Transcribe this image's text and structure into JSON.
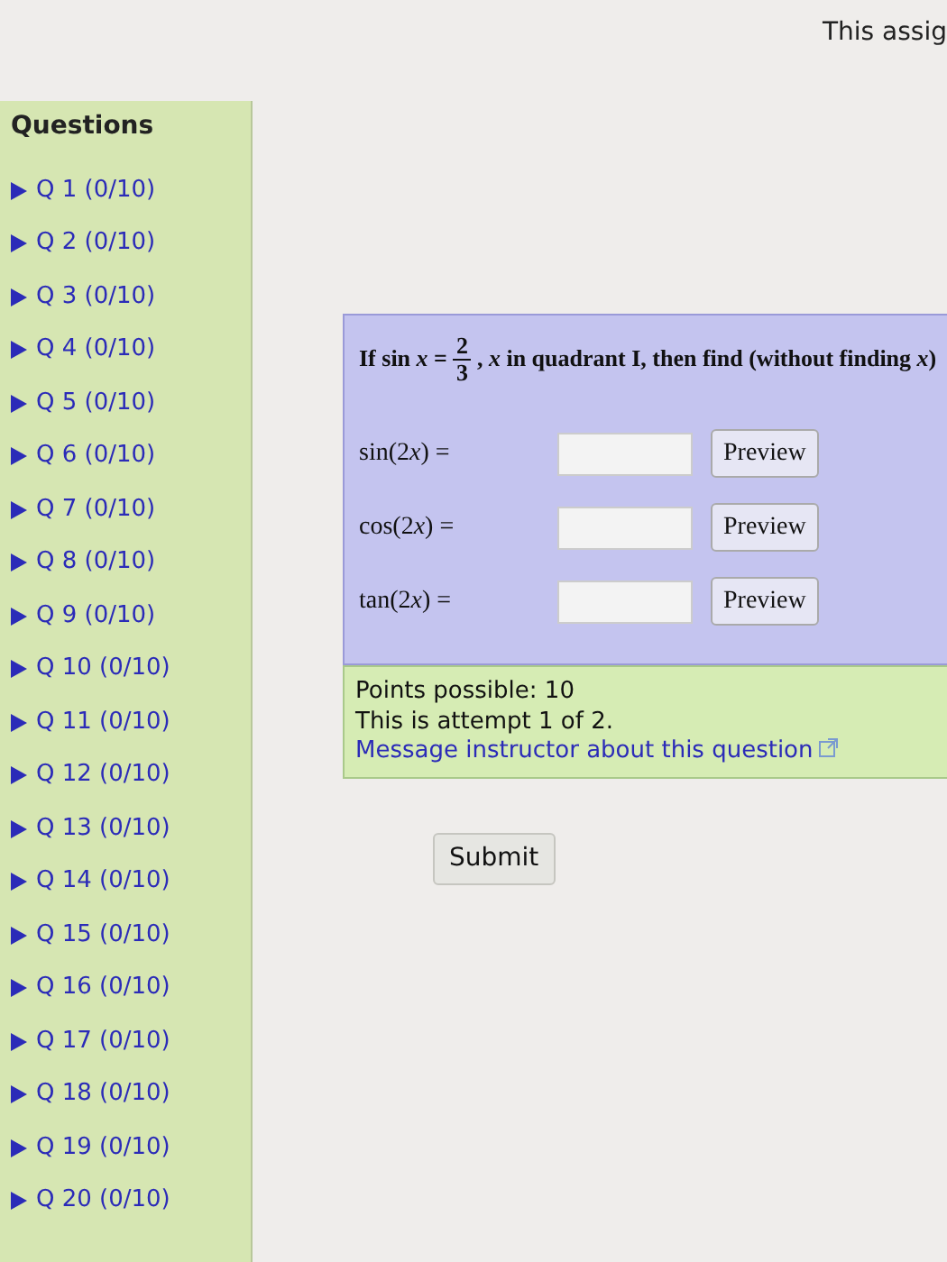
{
  "header": {
    "text": "This assig"
  },
  "sidebar": {
    "title": "Questions",
    "items": [
      {
        "label": "Q 1 (0/10)"
      },
      {
        "label": "Q 2 (0/10)"
      },
      {
        "label": "Q 3 (0/10)"
      },
      {
        "label": "Q 4 (0/10)"
      },
      {
        "label": "Q 5 (0/10)"
      },
      {
        "label": "Q 6 (0/10)"
      },
      {
        "label": "Q 7 (0/10)"
      },
      {
        "label": "Q 8 (0/10)"
      },
      {
        "label": "Q 9 (0/10)"
      },
      {
        "label": "Q 10 (0/10)"
      },
      {
        "label": "Q 11 (0/10)"
      },
      {
        "label": "Q 12 (0/10)"
      },
      {
        "label": "Q 13 (0/10)"
      },
      {
        "label": "Q 14 (0/10)"
      },
      {
        "label": "Q 15 (0/10)"
      },
      {
        "label": "Q 16 (0/10)"
      },
      {
        "label": "Q 17 (0/10)"
      },
      {
        "label": "Q 18 (0/10)"
      },
      {
        "label": "Q 19 (0/10)"
      },
      {
        "label": "Q 20 (0/10)"
      }
    ]
  },
  "question": {
    "prompt_start": "If sin *x* =",
    "numerator": "2",
    "denominator": "3",
    "prompt_end": ", *x* in quadrant I, then find (without finding *x*)",
    "answers": [
      {
        "before": "sin(2",
        "variable": "x",
        "after": ") =",
        "button": "Preview"
      },
      {
        "before": "cos(2",
        "variable": "x",
        "after": ") =",
        "button": "Preview"
      },
      {
        "before": "tan(2",
        "variable": "x",
        "after": ") =",
        "button": "Preview"
      }
    ]
  },
  "info": {
    "lines": [
      "Points possible: 10",
      "This is attempt 1 of 2."
    ],
    "link": "Message instructor about this question"
  },
  "submit": "Submit"
}
